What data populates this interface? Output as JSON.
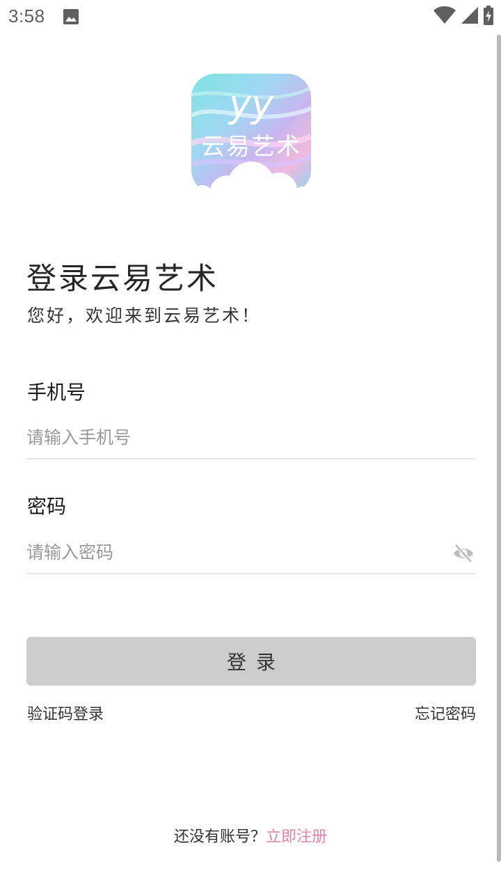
{
  "status_bar": {
    "time": "3:58",
    "icons": [
      "image-icon",
      "wifi-icon",
      "signal-icon",
      "battery-charging-icon"
    ]
  },
  "logo": {
    "mark": "yy",
    "name": "云易艺术"
  },
  "title": "登录云易艺术",
  "subtitle": "您好，欢迎来到云易艺术！",
  "phone_field": {
    "label": "手机号",
    "placeholder": "请输入手机号",
    "value": ""
  },
  "password_field": {
    "label": "密码",
    "placeholder": "请输入密码",
    "value": "",
    "toggle_icon": "eye-off-icon"
  },
  "login_button": {
    "label": "登录"
  },
  "links": {
    "code_login": "验证码登录",
    "forgot_password": "忘记密码"
  },
  "footer": {
    "text": "还没有账号？",
    "register_link": "立即注册"
  },
  "colors": {
    "button_bg": "#cccccc",
    "register_link": "#e781a8",
    "text": "#262626"
  }
}
